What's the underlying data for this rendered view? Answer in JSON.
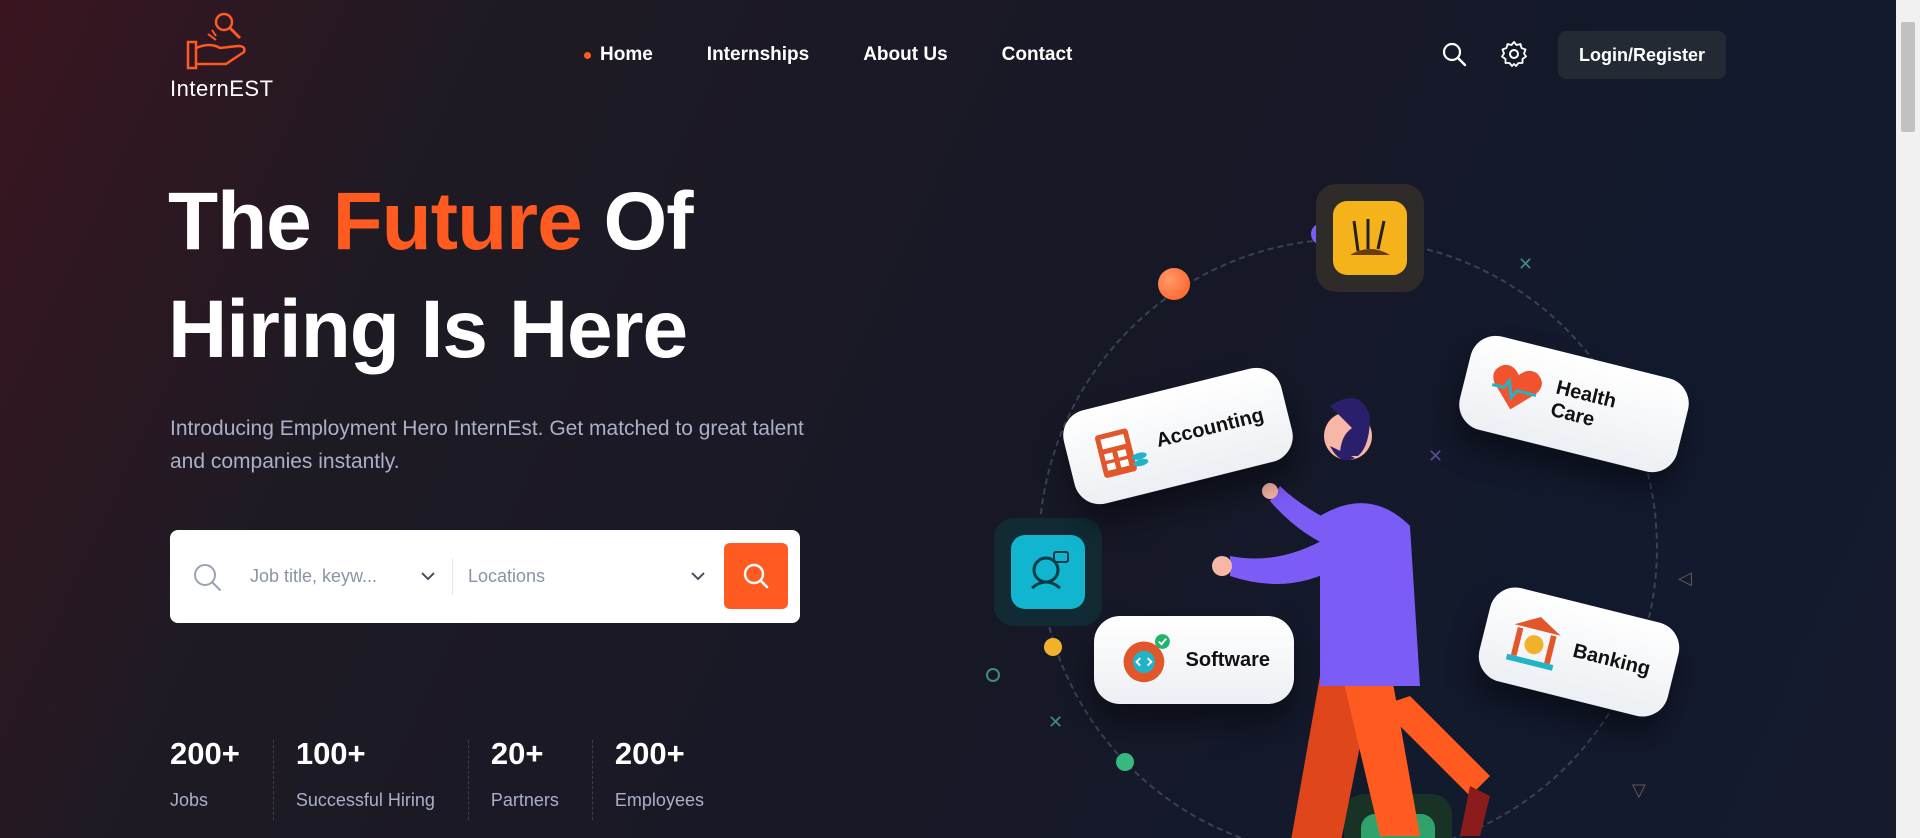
{
  "brand": {
    "logo_text": "InternEST"
  },
  "nav": [
    {
      "label": "Home",
      "active": true
    },
    {
      "label": "Internships"
    },
    {
      "label": "About Us"
    },
    {
      "label": "Contact"
    }
  ],
  "header": {
    "search_icon": "search-icon",
    "settings_icon": "gear-icon",
    "login_label": "Login/Register"
  },
  "hero": {
    "title_part1": "The ",
    "title_accent": "Future",
    "title_part2": " Of",
    "title_line2": "Hiring Is Here",
    "subtitle": "Introducing Employment Hero InternEst. Get matched to great talent and companies instantly."
  },
  "search": {
    "keyword_placeholder": "Job title, keyw...",
    "location_placeholder": "Locations"
  },
  "stats": [
    {
      "value": "200+",
      "label": "Jobs"
    },
    {
      "value": "100+",
      "label": "Successful Hiring"
    },
    {
      "value": "20+",
      "label": "Partners"
    },
    {
      "value": "200+",
      "label": "Employees"
    }
  ],
  "categories": [
    {
      "label": "Accounting",
      "icon": "calculator-icon"
    },
    {
      "label": "Health Care",
      "icon": "heart-icon"
    },
    {
      "label": "Software",
      "icon": "gear-code-icon"
    },
    {
      "label": "Banking",
      "icon": "bank-icon"
    }
  ],
  "colors": {
    "accent": "#ff5a1f",
    "purple": "#7b5cf5",
    "card_bg": "#ffffff"
  }
}
